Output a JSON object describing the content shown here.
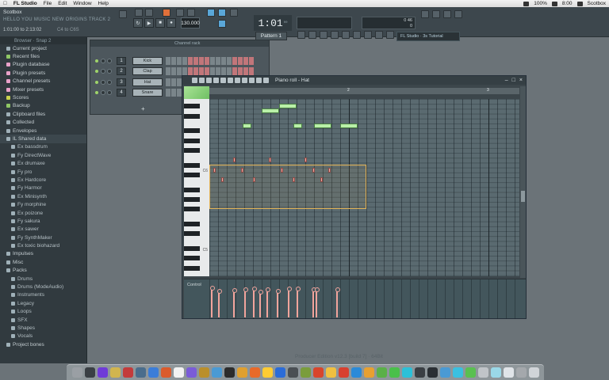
{
  "menubar": {
    "apple": "",
    "items": [
      "FL Studio",
      "File",
      "Edit",
      "Window",
      "Help"
    ],
    "status": {
      "battery": "100%",
      "time": "8:00",
      "user": "Scotbox"
    }
  },
  "toolbar": {
    "title": "Scotbox",
    "subtitle": "HELLO YOU MUSIC NEW ORIGINS TRACK 2",
    "position": "1:01:00 to 2:13:02",
    "position_b": "C4 to C6S",
    "tempo": "130.000",
    "time_main": "1:01",
    "time_sub": "00",
    "pattern": "Pattern 1",
    "cpu_top": "0 46",
    "cpu_bottom": "0",
    "hint": "FL Studio · 3s Tutorial"
  },
  "browser": {
    "header": "Browser · Snap 2",
    "items": [
      {
        "label": "Current project",
        "color": "#9fb0b8",
        "sub": false
      },
      {
        "label": "Recent files",
        "color": "#8fc765",
        "sub": false
      },
      {
        "label": "Plugin database",
        "color": "#e8a1c9",
        "sub": false
      },
      {
        "label": "Plugin presets",
        "color": "#e8a1c9",
        "sub": false
      },
      {
        "label": "Channel presets",
        "color": "#e8a1c9",
        "sub": false
      },
      {
        "label": "Mixer presets",
        "color": "#e8a1c9",
        "sub": false
      },
      {
        "label": "Scores",
        "color": "#c9d24e",
        "sub": false
      },
      {
        "label": "Backup",
        "color": "#8fc765",
        "sub": false
      },
      {
        "label": "Clipboard files",
        "color": "#9fb0b8",
        "sub": false
      },
      {
        "label": "Collected",
        "color": "#9fb0b8",
        "sub": false
      },
      {
        "label": "Envelopes",
        "color": "#9fb0b8",
        "sub": false
      },
      {
        "label": "IL Shared data",
        "color": "#9fb0b8",
        "sub": false,
        "sel": true
      },
      {
        "label": "Ex bassdrum",
        "color": "#9fb0b8",
        "sub": true
      },
      {
        "label": "Fy DirectWave",
        "color": "#9fb0b8",
        "sub": true
      },
      {
        "label": "Ex drumaxe",
        "color": "#9fb0b8",
        "sub": true
      },
      {
        "label": "Fy pro",
        "color": "#9fb0b8",
        "sub": true
      },
      {
        "label": "Ex Hardcore",
        "color": "#9fb0b8",
        "sub": true
      },
      {
        "label": "Fy Harmor",
        "color": "#9fb0b8",
        "sub": true
      },
      {
        "label": "Ex Minisynth",
        "color": "#9fb0b8",
        "sub": true
      },
      {
        "label": "Fy morphine",
        "color": "#9fb0b8",
        "sub": true
      },
      {
        "label": "Ex poizone",
        "color": "#9fb0b8",
        "sub": true
      },
      {
        "label": "Fy sakura",
        "color": "#9fb0b8",
        "sub": true
      },
      {
        "label": "Ex sawer",
        "color": "#9fb0b8",
        "sub": true
      },
      {
        "label": "Fy SynthMaker",
        "color": "#9fb0b8",
        "sub": true
      },
      {
        "label": "Ex toxic biohazard",
        "color": "#9fb0b8",
        "sub": true
      },
      {
        "label": "Impulses",
        "color": "#9fb0b8",
        "sub": false
      },
      {
        "label": "Misc",
        "color": "#9fb0b8",
        "sub": false
      },
      {
        "label": "Packs",
        "color": "#9fb0b8",
        "sub": false
      },
      {
        "label": "Drums",
        "color": "#9fb0b8",
        "sub": true
      },
      {
        "label": "Drums (ModeAudio)",
        "color": "#9fb0b8",
        "sub": true
      },
      {
        "label": "Instruments",
        "color": "#9fb0b8",
        "sub": true
      },
      {
        "label": "Legacy",
        "color": "#9fb0b8",
        "sub": true
      },
      {
        "label": "Loops",
        "color": "#9fb0b8",
        "sub": true
      },
      {
        "label": "SFX",
        "color": "#9fb0b8",
        "sub": true
      },
      {
        "label": "Shapes",
        "color": "#9fb0b8",
        "sub": true
      },
      {
        "label": "Vocals",
        "color": "#9fb0b8",
        "sub": true
      },
      {
        "label": "Project bones",
        "color": "#9fb0b8",
        "sub": false
      }
    ]
  },
  "rack": {
    "header": "Channel rack",
    "add": "+",
    "channels": [
      {
        "num": "1",
        "name": "Kick"
      },
      {
        "num": "2",
        "name": "Clap"
      },
      {
        "num": "3",
        "name": "Hat"
      },
      {
        "num": "4",
        "name": "Snare"
      }
    ]
  },
  "piano_roll": {
    "title": "Piano roll - Hat",
    "ruler": [
      "2",
      "3"
    ],
    "key_labels": [
      "C6",
      "C5"
    ],
    "control_label": "Control",
    "notes_green": [
      {
        "start": 3.8,
        "len": 1.0,
        "row": 5
      },
      {
        "start": 6.0,
        "len": 2.0,
        "row": 2
      },
      {
        "start": 8.0,
        "len": 2.0,
        "row": 1
      },
      {
        "start": 9.6,
        "len": 1.0,
        "row": 5
      },
      {
        "start": 12.0,
        "len": 2.0,
        "row": 5
      },
      {
        "start": 15.0,
        "len": 2.0,
        "row": 5
      }
    ],
    "notes_hat": [
      {
        "start": 0.2,
        "row": 14
      },
      {
        "start": 0.6,
        "row": 16
      },
      {
        "start": 1.2,
        "row": 12
      },
      {
        "start": 1.6,
        "row": 14
      },
      {
        "start": 2.2,
        "row": 16
      },
      {
        "start": 3.0,
        "row": 12
      },
      {
        "start": 3.6,
        "row": 14
      },
      {
        "start": 4.2,
        "row": 16
      },
      {
        "start": 4.8,
        "row": 12
      },
      {
        "start": 5.2,
        "row": 14
      },
      {
        "start": 5.6,
        "row": 16
      },
      {
        "start": 6.0,
        "row": 14
      }
    ],
    "velocities": [
      0.95,
      0.85,
      0.88,
      0.9,
      0.92,
      0.82,
      0.9,
      0.86,
      0.93,
      0.92,
      0.9,
      0.89,
      0.91
    ]
  },
  "watermark": "Producer Edition v12.3 [build 7] · 64Bit",
  "dock": [
    "#9a9fa4",
    "#3a3f44",
    "#6f3bd8",
    "#d1b54f",
    "#c33b3b",
    "#4a6d8c",
    "#3b7dd8",
    "#da5b2c",
    "#f2f2f2",
    "#7a5cd8",
    "#ba8f2c",
    "#4a9ad4",
    "#2c2c2c",
    "#e0a030",
    "#e86a2a",
    "#ffcc33",
    "#2b6cd8",
    "#4a4f54",
    "#7a9d3c",
    "#d8452c",
    "#f0c040",
    "#d84030",
    "#2a8ad8",
    "#e8a030",
    "#5ab048",
    "#4ac04a",
    "#2cc0d8",
    "#3a3f44",
    "#2a2f34",
    "#4a9ad4",
    "#3ac0e0",
    "#5ac050",
    "#c0c4c8",
    "#9ad8e8",
    "#e0e4e8",
    "#a4a8ac",
    "#d0d4d8"
  ]
}
